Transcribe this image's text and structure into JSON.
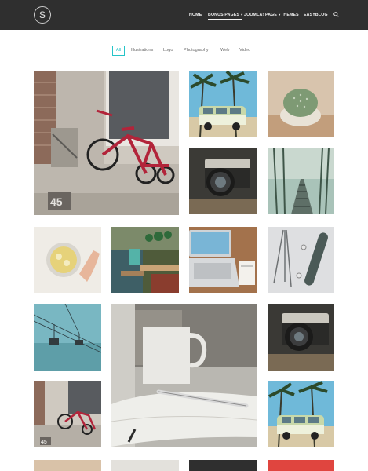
{
  "header": {
    "logo_letter": "S",
    "nav": [
      {
        "label": "HOME",
        "has_caret": false,
        "active": false
      },
      {
        "label": "BONUS PAGES",
        "has_caret": true,
        "active": true
      },
      {
        "label": "JOOMLA! PAGE",
        "has_caret": true,
        "active": false
      },
      {
        "label": "THEMES",
        "has_caret": false,
        "active": false
      },
      {
        "label": "EASYBLOG",
        "has_caret": false,
        "active": false
      }
    ],
    "search_icon": "search-icon",
    "background": "#2f2f2f"
  },
  "filters": [
    {
      "label": "All",
      "active": true
    },
    {
      "label": "Illustrations",
      "active": false
    },
    {
      "label": "Logo",
      "active": false
    },
    {
      "label": "Photography",
      "active": false
    },
    {
      "label": "Web",
      "active": false
    },
    {
      "label": "Video",
      "active": false
    }
  ],
  "accent_color": "#25c4c8",
  "gallery": [
    {
      "subject": "red tricycle by doorway"
    },
    {
      "subject": "vintage van under palm trees"
    },
    {
      "subject": "cactus in pot"
    },
    {
      "subject": "vintage camera on desk"
    },
    {
      "subject": "misty railroad forest"
    },
    {
      "subject": "tea cup with lemon"
    },
    {
      "subject": "cafe interior with plants"
    },
    {
      "subject": "laptop on wooden desk"
    },
    {
      "subject": "skateboard and tripod"
    },
    {
      "subject": "cable cars against sky"
    },
    {
      "subject": "notebook with pen and mug"
    },
    {
      "subject": "vintage camera"
    },
    {
      "subject": "red tricycle by doorway"
    },
    {
      "subject": "vintage van under palm trees"
    }
  ]
}
